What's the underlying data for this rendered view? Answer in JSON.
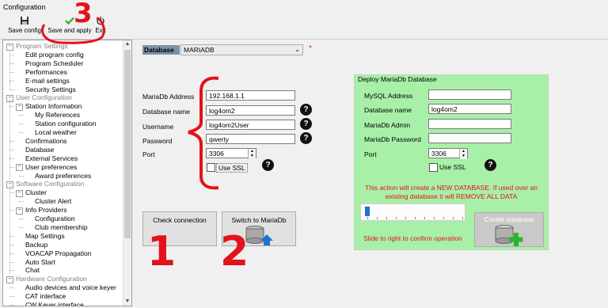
{
  "window": {
    "title": "Configuration"
  },
  "toolbar": {
    "save_label": "Save config",
    "save_apply_label": "Save and apply",
    "exit_label": "Exit"
  },
  "tree": {
    "items": [
      "Program Settings",
      "Edit program config",
      "Program Scheduler",
      "Performances",
      "E-mail settings",
      "Security Settings",
      "User Configuration",
      "Station Information",
      "My References",
      "Station configuration",
      "Local weather",
      "Confirmations",
      "Database",
      "External Services",
      "User preferences",
      "Award preferences",
      "Software Configuration",
      "Cluster",
      "Cluster Alert",
      "Info Providers",
      "Configuration",
      "Club membership",
      "Map Settings",
      "Backup",
      "VOACAP Propagation",
      "Auto Start",
      "Chat",
      "Hardware Configuration",
      "Audio devices and voice keyer",
      "CAT interface",
      "CW Keyer interface"
    ]
  },
  "database": {
    "label": "Database",
    "selected": "MARIADB",
    "required_mark": "*"
  },
  "connection": {
    "address_label": "MariaDb Address",
    "address_value": "192.168.1.1",
    "dbname_label": "Database name",
    "dbname_value": "log4om2",
    "username_label": "Username",
    "username_value": "log4om2User",
    "password_label": "Password",
    "password_value": "qwerty",
    "port_label": "Port",
    "port_value": "3306",
    "ssl_label": "Use SSL",
    "help_glyph": "?"
  },
  "buttons": {
    "check_connection": "Check connection",
    "switch_mariadb": "Switch to MariaDb"
  },
  "deploy": {
    "title": "Deploy MariaDb Database",
    "address_label": "MySQL Address",
    "address_value": "",
    "dbname_label": "Database name",
    "dbname_value": "log4om2",
    "admin_label": "MariaDb Admin",
    "admin_value": "",
    "password_label": "MariaDb Password",
    "password_value": "",
    "port_label": "Port",
    "port_value": "3306",
    "ssl_label": "Use SSL",
    "warning_line1": "This action will create a NEW DATABASE. If used over an",
    "warning_line2": "existing database it will REMOVE ALL DATA",
    "slider_label": "Slide to right to confirm operation",
    "slider_position": 0,
    "create_label": "Create database"
  },
  "annotations": {
    "one": "1",
    "two": "2",
    "three": "3"
  },
  "colors": {
    "deploy_bg": "#a8f0a8",
    "warning": "#e3121b",
    "annotation": "#e3121b",
    "slider": "#1f6fd6"
  }
}
